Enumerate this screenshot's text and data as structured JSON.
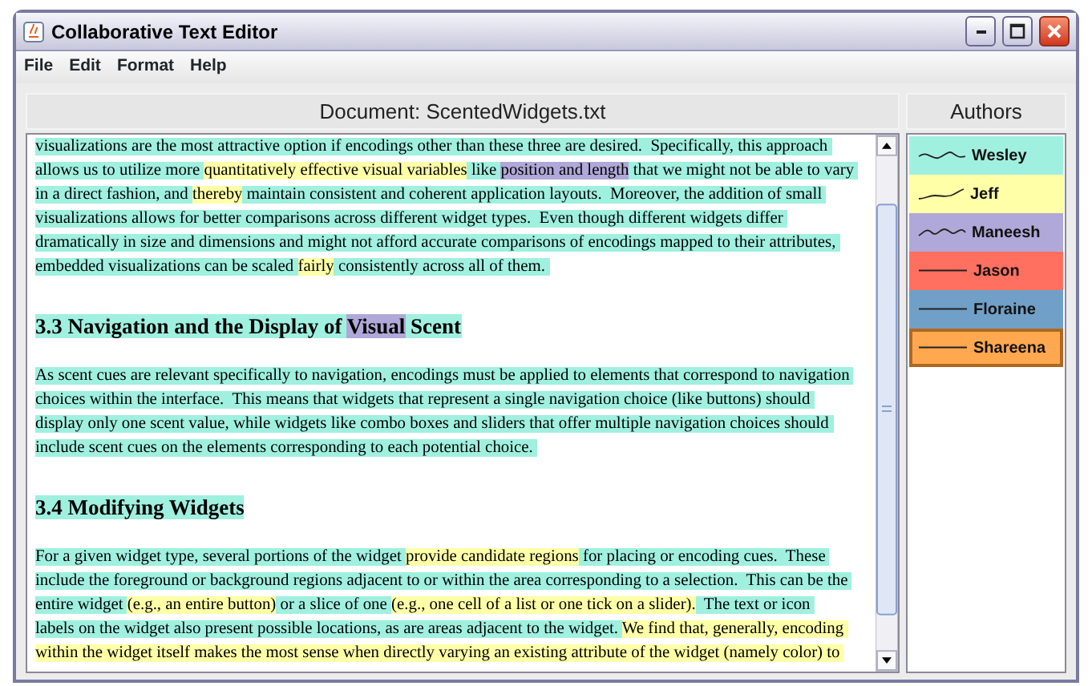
{
  "window": {
    "title": "Collaborative Text Editor"
  },
  "menu": [
    "File",
    "Edit",
    "Format",
    "Help"
  ],
  "document": {
    "title": "Document: ScentedWidgets.txt",
    "blocks": [
      {
        "kind": "body",
        "lines": [
          [
            {
              "text": "visualizations are the most attractive option if encodings other than these three are desired.  Specifically, this approach ",
              "color": "#a0f0e0"
            }
          ],
          [
            {
              "text": "allows us to utilize more ",
              "color": "#a0f0e0"
            },
            {
              "text": "quantitatively effective visual variables",
              "color": "#ffffa8"
            },
            {
              "text": " like ",
              "color": "#a0f0e0"
            },
            {
              "text": "position and length",
              "color": "#b0a8d8"
            },
            {
              "text": " that we might not be able to vary ",
              "color": "#a0f0e0"
            }
          ],
          [
            {
              "text": "in a direct fashion, and ",
              "color": "#a0f0e0"
            },
            {
              "text": "thereby",
              "color": "#ffffa8"
            },
            {
              "text": " maintain consistent and coherent application layouts.  Moreover, the addition of small ",
              "color": "#a0f0e0"
            }
          ],
          [
            {
              "text": "visualizations allows for better comparisons across different widget types.  Even though different widgets differ ",
              "color": "#a0f0e0"
            }
          ],
          [
            {
              "text": "dramatically in size and dimensions and might not afford accurate comparisons of encodings mapped to their attributes, ",
              "color": "#a0f0e0"
            }
          ],
          [
            {
              "text": "embedded visualizations can be scaled ",
              "color": "#a0f0e0"
            },
            {
              "text": "fairly",
              "color": "#ffffa8"
            },
            {
              "text": " consistently across all of them. ",
              "color": "#a0f0e0"
            }
          ]
        ]
      },
      {
        "kind": "heading",
        "lines": [
          [
            {
              "text": "3.3 Navigation and the Display of ",
              "color": "#a0f0e0"
            },
            {
              "text": "Visual",
              "color": "#b0a8d8"
            },
            {
              "text": " Scent",
              "color": "#a0f0e0"
            }
          ]
        ]
      },
      {
        "kind": "body",
        "lines": [
          [
            {
              "text": "As scent cues are relevant specifically to navigation, encodings must be applied to elements that correspond to navigation ",
              "color": "#a0f0e0"
            }
          ],
          [
            {
              "text": "choices within the interface.  This means that widgets that represent a single navigation choice (like buttons) should ",
              "color": "#a0f0e0"
            }
          ],
          [
            {
              "text": "display only one scent value, while widgets like combo boxes and sliders that offer multiple navigation choices should ",
              "color": "#a0f0e0"
            }
          ],
          [
            {
              "text": "include scent cues on the elements corresponding to each potential choice. ",
              "color": "#a0f0e0"
            }
          ]
        ]
      },
      {
        "kind": "heading",
        "lines": [
          [
            {
              "text": "3.4 Modifying Widgets",
              "color": "#a0f0e0"
            }
          ]
        ]
      },
      {
        "kind": "body",
        "lines": [
          [
            {
              "text": "For a given widget type, several portions of the widget ",
              "color": "#a0f0e0"
            },
            {
              "text": "provide candidate regions",
              "color": "#ffffa8"
            },
            {
              "text": " for placing or encoding cues.  These ",
              "color": "#a0f0e0"
            }
          ],
          [
            {
              "text": "include the foreground or background regions adjacent to or within the area corresponding to a selection.  This can be the ",
              "color": "#a0f0e0"
            }
          ],
          [
            {
              "text": "entire widget ",
              "color": "#a0f0e0"
            },
            {
              "text": "(e.g., an entire button)",
              "color": "#ffffa8"
            },
            {
              "text": " or a slice of one ",
              "color": "#a0f0e0"
            },
            {
              "text": "(e.g., one cell of a list or one tick on a slider).",
              "color": "#ffffa8"
            },
            {
              "text": "  The text or icon ",
              "color": "#a0f0e0"
            }
          ],
          [
            {
              "text": "labels on the widget also present possible locations, as are areas adjacent to the widget. ",
              "color": "#a0f0e0"
            },
            {
              "text": "We find that, generally, encoding ",
              "color": "#ffffa8"
            }
          ],
          [
            {
              "text": "within the widget itself makes the most sense when directly varying an existing attribute of the widget (namely color) to ",
              "color": "#ffffa8"
            }
          ]
        ]
      }
    ]
  },
  "authors_panel": {
    "title": "Authors",
    "authors": [
      {
        "name": "Wesley",
        "color": "#a0f0e0",
        "selected": false
      },
      {
        "name": "Jeff",
        "color": "#ffffa8",
        "selected": false
      },
      {
        "name": "Maneesh",
        "color": "#b0a8d8",
        "selected": false
      },
      {
        "name": "Jason",
        "color": "#ff7060",
        "selected": false
      },
      {
        "name": "Floraine",
        "color": "#70a0c8",
        "selected": false
      },
      {
        "name": "Shareena",
        "color": "#ffa850",
        "selected": true
      }
    ]
  }
}
